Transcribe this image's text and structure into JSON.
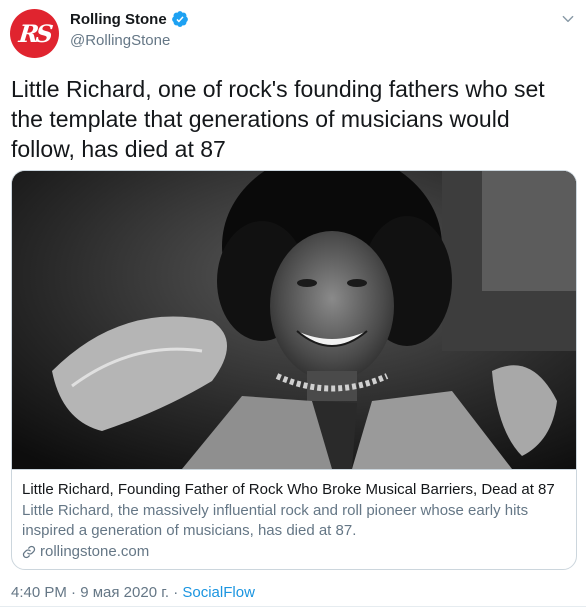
{
  "author": {
    "avatar_text": "RS",
    "name": "Rolling Stone",
    "handle": "@RollingStone",
    "verified": true
  },
  "tweet": {
    "text": "Little Richard, one of rock's founding fathers who set the template that generations of musicians would follow, has died at 87"
  },
  "card": {
    "title": "Little Richard, Founding Father of Rock Who Broke Musical Barriers, Dead at 87",
    "description": "Little Richard, the massively influential rock and roll pioneer whose early hits inspired a generation of musicians, has died at 87.",
    "domain": "rollingstone.com"
  },
  "meta": {
    "time": "4:40 PM",
    "date": "9 мая 2020 г.",
    "source": "SocialFlow",
    "separator": "·"
  },
  "icons": {
    "verified": "verified-badge-icon",
    "more": "chevron-down-icon",
    "link": "link-icon"
  },
  "colors": {
    "avatar_bg": "#e0242f",
    "verified": "#1da1f2",
    "muted": "#657786",
    "link": "#1b95e0",
    "border": "#ccd6dd"
  }
}
